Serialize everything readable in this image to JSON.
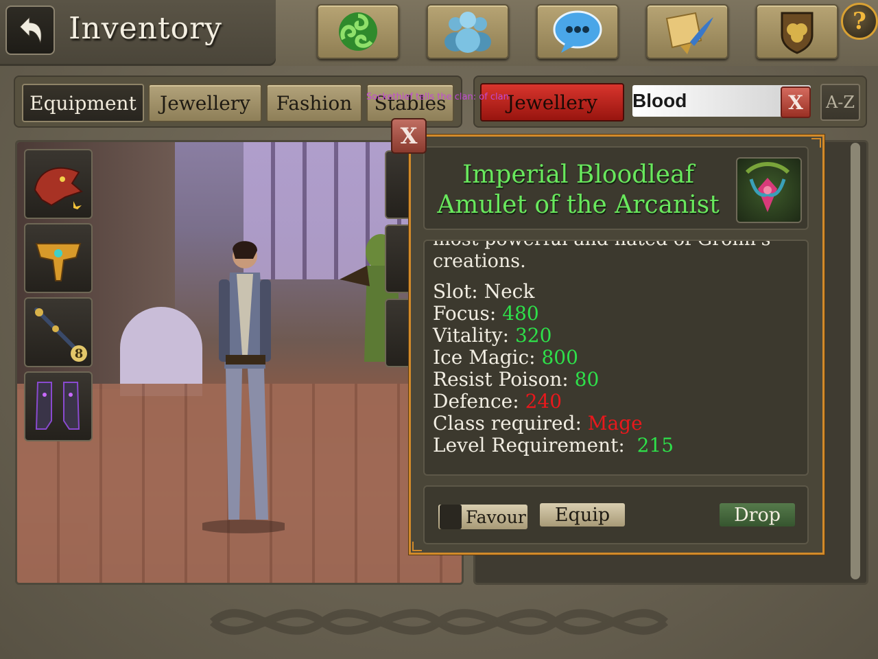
{
  "header": {
    "title": "Inventory",
    "nav_icons": [
      "triskele-icon",
      "party-icon",
      "chat-icon",
      "quest-scroll-icon",
      "clan-shield-icon"
    ],
    "help_label": "?"
  },
  "tabs": [
    {
      "label": "Equipment",
      "active": true
    },
    {
      "label": "Jewellery",
      "active": false
    },
    {
      "label": "Fashion",
      "active": false
    },
    {
      "label": "Stables",
      "active": false
    }
  ],
  "chat_overlay": "Sockethief tells the clan: of clan",
  "filter": {
    "category": "Jewellery",
    "search_value": "Blood",
    "clear_label": "X",
    "sort_label": "A-Z"
  },
  "equipped_slots": [
    {
      "name": "dragon-helm-icon",
      "badge": ""
    },
    {
      "name": "golden-pauldron-icon",
      "badge": ""
    },
    {
      "name": "wand-icon",
      "badge": "8"
    },
    {
      "name": "boots-icon",
      "badge": ""
    }
  ],
  "popup": {
    "close_label": "X",
    "item_name_line1": "Imperial Bloodleaf",
    "item_name_line2": "Amulet of the Arcanist",
    "description_partial": "most powerful and hated of Gronn's",
    "description_end": "creations.",
    "stats": [
      {
        "label": "Slot:",
        "value": "Neck",
        "color": "white"
      },
      {
        "label": "Focus:",
        "value": "480",
        "color": "green"
      },
      {
        "label": "Vitality:",
        "value": "320",
        "color": "green"
      },
      {
        "label": "Ice Magic:",
        "value": "800",
        "color": "green"
      },
      {
        "label": "Resist Poison:",
        "value": "80",
        "color": "green"
      },
      {
        "label": "Defence:",
        "value": "240",
        "color": "red"
      },
      {
        "label": "Class required:",
        "value": "Mage",
        "color": "red"
      },
      {
        "label": "Level Requirement:",
        "value": "215",
        "color": "green"
      }
    ],
    "favour_label": "Favour",
    "equip_label": "Equip",
    "drop_label": "Drop"
  },
  "colors": {
    "accent_green": "#2ee04a",
    "warning_red": "#e8181c",
    "title_green": "#69e85d",
    "popup_border": "#d28a2a"
  }
}
